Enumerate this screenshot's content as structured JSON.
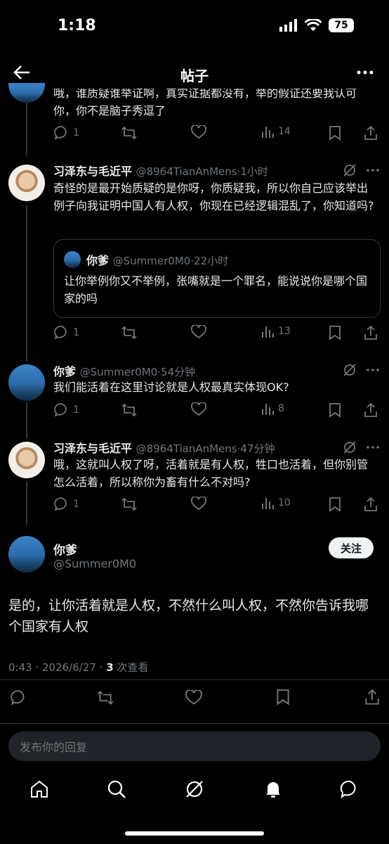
{
  "status": {
    "time": "1:18",
    "battery": "75"
  },
  "header": {
    "title": "帖子"
  },
  "posts": [
    {
      "text": "哦，谁质疑谁举证啊，真实证据都没有，举的假证还要我认可你，你不是脑子秀逗了",
      "replies": "1",
      "views": "14"
    },
    {
      "name": "习泽东与毛近平",
      "handle": "@8964TianAnMens",
      "time": "·1小时",
      "text": "奇怪的是最开始质疑的是你呀，你质疑我，所以你自己应该举出例子向我证明中国人有人权，你现在已经逻辑混乱了，你知道吗?",
      "quote": {
        "name": "你爹",
        "handle": "@Summer0M0",
        "time": "·22小时",
        "text": "让你举例你又不举例，张嘴就是一个罪名，能说说你是哪个国家的吗"
      },
      "replies": "1",
      "views": "13"
    },
    {
      "name": "你爹",
      "handle": "@Summer0M0",
      "time": "·54分钟",
      "text": "我们能活着在这里讨论就是人权最真实体现OK?",
      "replies": "1",
      "views": "8"
    },
    {
      "name": "习泽东与毛近平",
      "handle": "@8964TianAnMens",
      "time": "·47分钟",
      "text": "哦，这就叫人权了呀，活着就是有人权，牲口也活着，但你别管怎么活着，所以称你为畜有什么不对吗?",
      "replies": "1",
      "views": "10"
    }
  ],
  "main": {
    "name": "你爹",
    "handle": "@Summer0M0",
    "follow": "关注",
    "text": "是的，让你活着就是人权，不然什么叫人权，不然你告诉我哪个国家有人权",
    "meta_time": "0:43 · 2026/6/27 · ",
    "views_count": "3",
    "views_label": " 次查看"
  },
  "reply_placeholder": "发布你的回复"
}
